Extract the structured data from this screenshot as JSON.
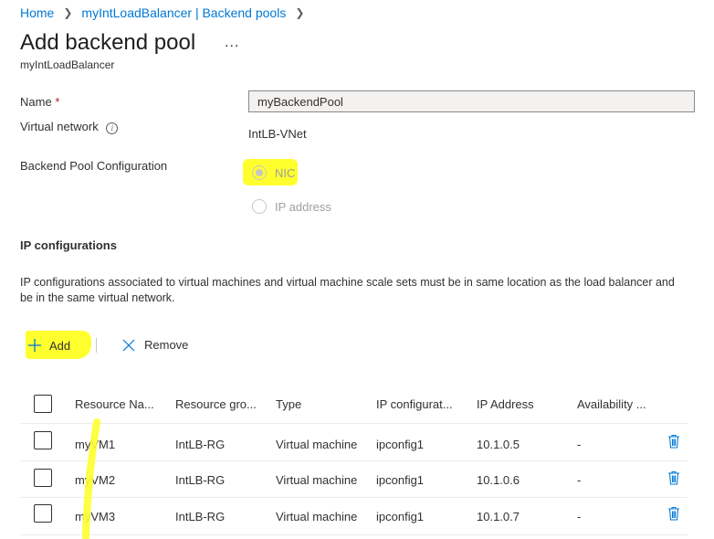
{
  "breadcrumb": {
    "home": "Home",
    "parent": "myIntLoadBalancer | Backend pools"
  },
  "page": {
    "title": "Add backend pool",
    "subtitle": "myIntLoadBalancer",
    "more_label": "..."
  },
  "form": {
    "name_label": "Name",
    "required_mark": "*",
    "name_value": "myBackendPool",
    "vnet_label": "Virtual network",
    "vnet_value": "IntLB-VNet",
    "pool_config_label": "Backend Pool Configuration",
    "pool_config_options": [
      "NIC",
      "IP address"
    ],
    "pool_config_selected": "NIC"
  },
  "ip_configurations": {
    "title": "IP configurations",
    "description": "IP configurations associated to virtual machines and virtual machine scale sets must be in same location as the load balancer and be in the same virtual network.",
    "add_label": "Add",
    "remove_label": "Remove",
    "columns": [
      "Resource Na...",
      "Resource gro...",
      "Type",
      "IP configurat...",
      "IP Address",
      "Availability ..."
    ],
    "rows": [
      [
        "myVM1",
        "IntLB-RG",
        "Virtual machine",
        "ipconfig1",
        "10.1.0.5",
        "-"
      ],
      [
        "myVM2",
        "IntLB-RG",
        "Virtual machine",
        "ipconfig1",
        "10.1.0.6",
        "-"
      ],
      [
        "myVM3",
        "IntLB-RG",
        "Virtual machine",
        "ipconfig1",
        "10.1.0.7",
        "-"
      ]
    ]
  },
  "colors": {
    "link": "#0078d4",
    "highlight": "#ffff2e",
    "required": "#a4262c"
  }
}
